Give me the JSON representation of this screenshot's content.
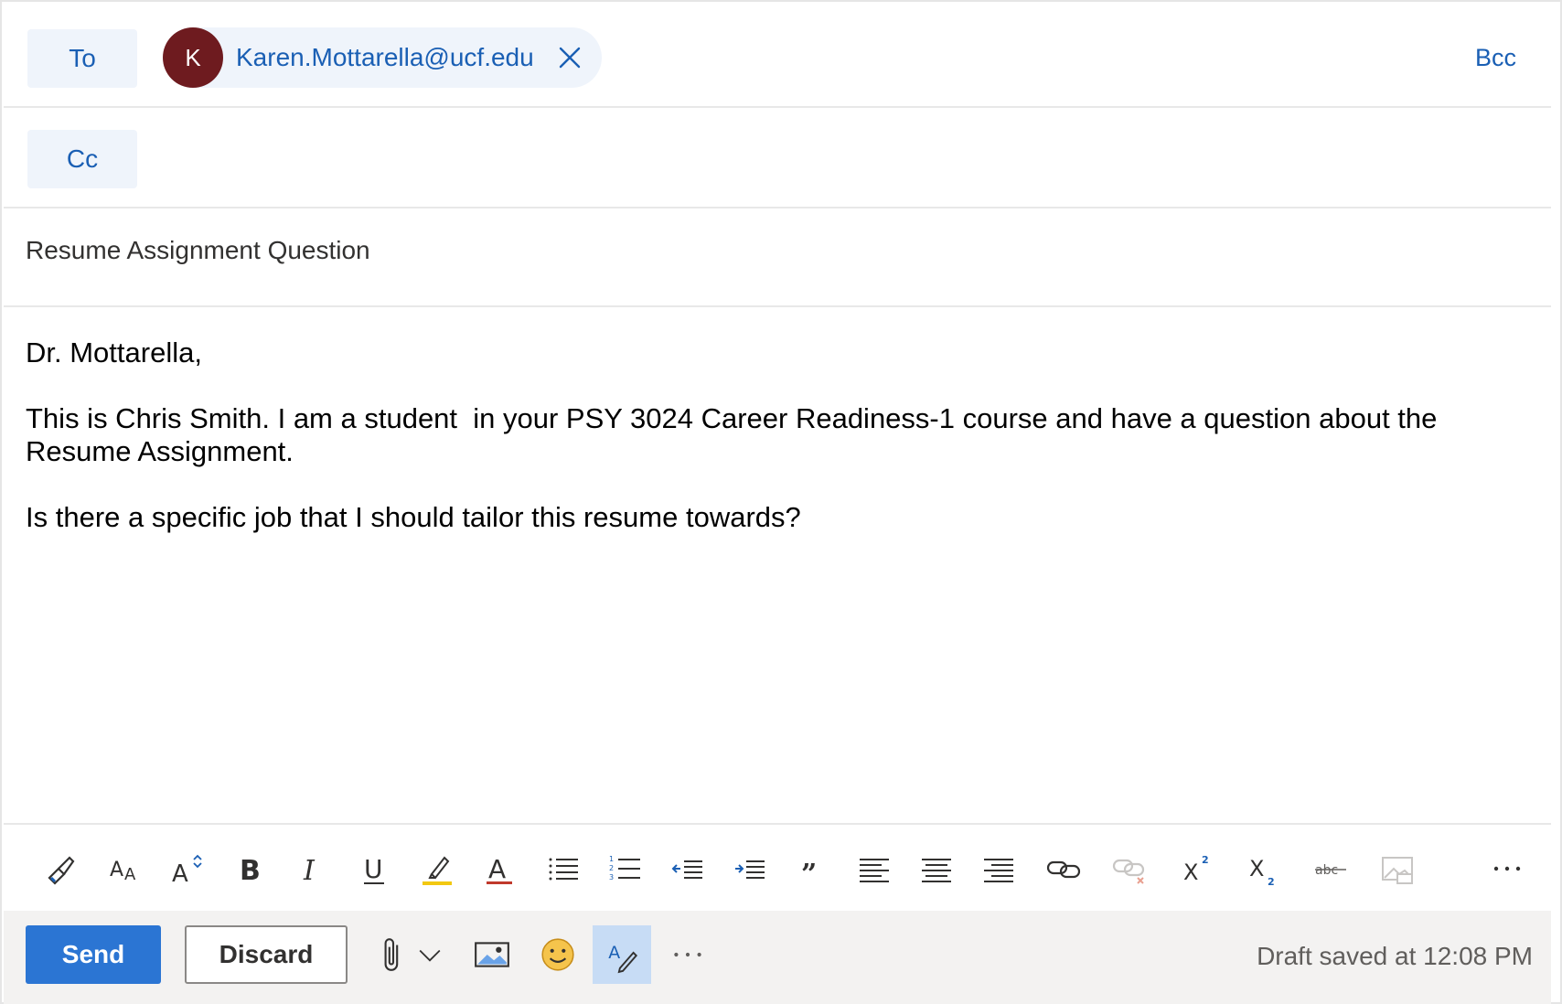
{
  "recipients": {
    "to_label": "To",
    "cc_label": "Cc",
    "bcc_label": "Bcc",
    "to_chip": {
      "initial": "K",
      "email": "Karen.Mottarella@ucf.edu",
      "avatar_color": "#6e1b1f"
    }
  },
  "subject": "Resume Assignment Question",
  "body": {
    "greeting": "Dr. Mottarella,",
    "para1": "This is Chris Smith. I am a student  in your PSY 3024 Career Readiness-1 course and have a question about the Resume Assignment.",
    "para2": "Is there a specific job that I should tailor this resume towards?"
  },
  "toolbar": {
    "icons": [
      "format-painter-icon",
      "font-size-icon",
      "grow-font-icon",
      "bold-icon",
      "italic-icon",
      "underline-icon",
      "highlight-icon",
      "font-color-icon",
      "bullets-icon",
      "numbering-icon",
      "decrease-indent-icon",
      "increase-indent-icon",
      "quote-icon",
      "align-left-icon",
      "align-center-icon",
      "align-right-icon",
      "link-icon",
      "unlink-icon",
      "superscript-icon",
      "subscript-icon",
      "strikethrough-icon",
      "insert-image-inline-icon",
      "more-options-icon"
    ]
  },
  "footer": {
    "send_label": "Send",
    "discard_label": "Discard",
    "draft_status": "Draft saved at 12:08 PM"
  },
  "colors": {
    "accent": "#2b75d3",
    "link": "#1a5fb4",
    "chip_bg": "#eff4fb",
    "footer_bg": "#f3f2f1"
  }
}
